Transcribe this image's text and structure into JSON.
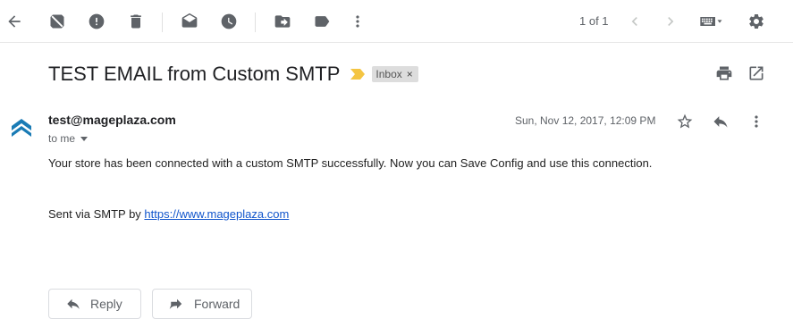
{
  "toolbar": {
    "icons": [
      "back-arrow-icon",
      "not-spam-icon",
      "report-spam-icon",
      "delete-icon",
      "mark-unread-icon",
      "snooze-icon",
      "move-to-icon",
      "labels-icon",
      "more-vert-icon",
      "chevron-left-icon",
      "chevron-right-icon",
      "keyboard-icon",
      "settings-icon"
    ],
    "pager": "1 of 1"
  },
  "email": {
    "subject": "TEST EMAIL from Custom SMTP",
    "label": "Inbox",
    "label_remove": "×",
    "sender": "test@mageplaza.com",
    "recipient": "to me",
    "timestamp": "Sun, Nov 12, 2017, 12:09 PM",
    "body_line_1": "Your store has been connected with a custom SMTP successfully. Now you can Save Config and use this connection.",
    "body_line_2_prefix": "Sent via SMTP by ",
    "body_link": "https://www.mageplaza.com"
  },
  "actions": {
    "reply_label": "Reply",
    "forward_label": "Forward"
  },
  "colors": {
    "important_marker": "#f4c542",
    "link": "#1155cc",
    "avatar": "#1a7bb5"
  }
}
